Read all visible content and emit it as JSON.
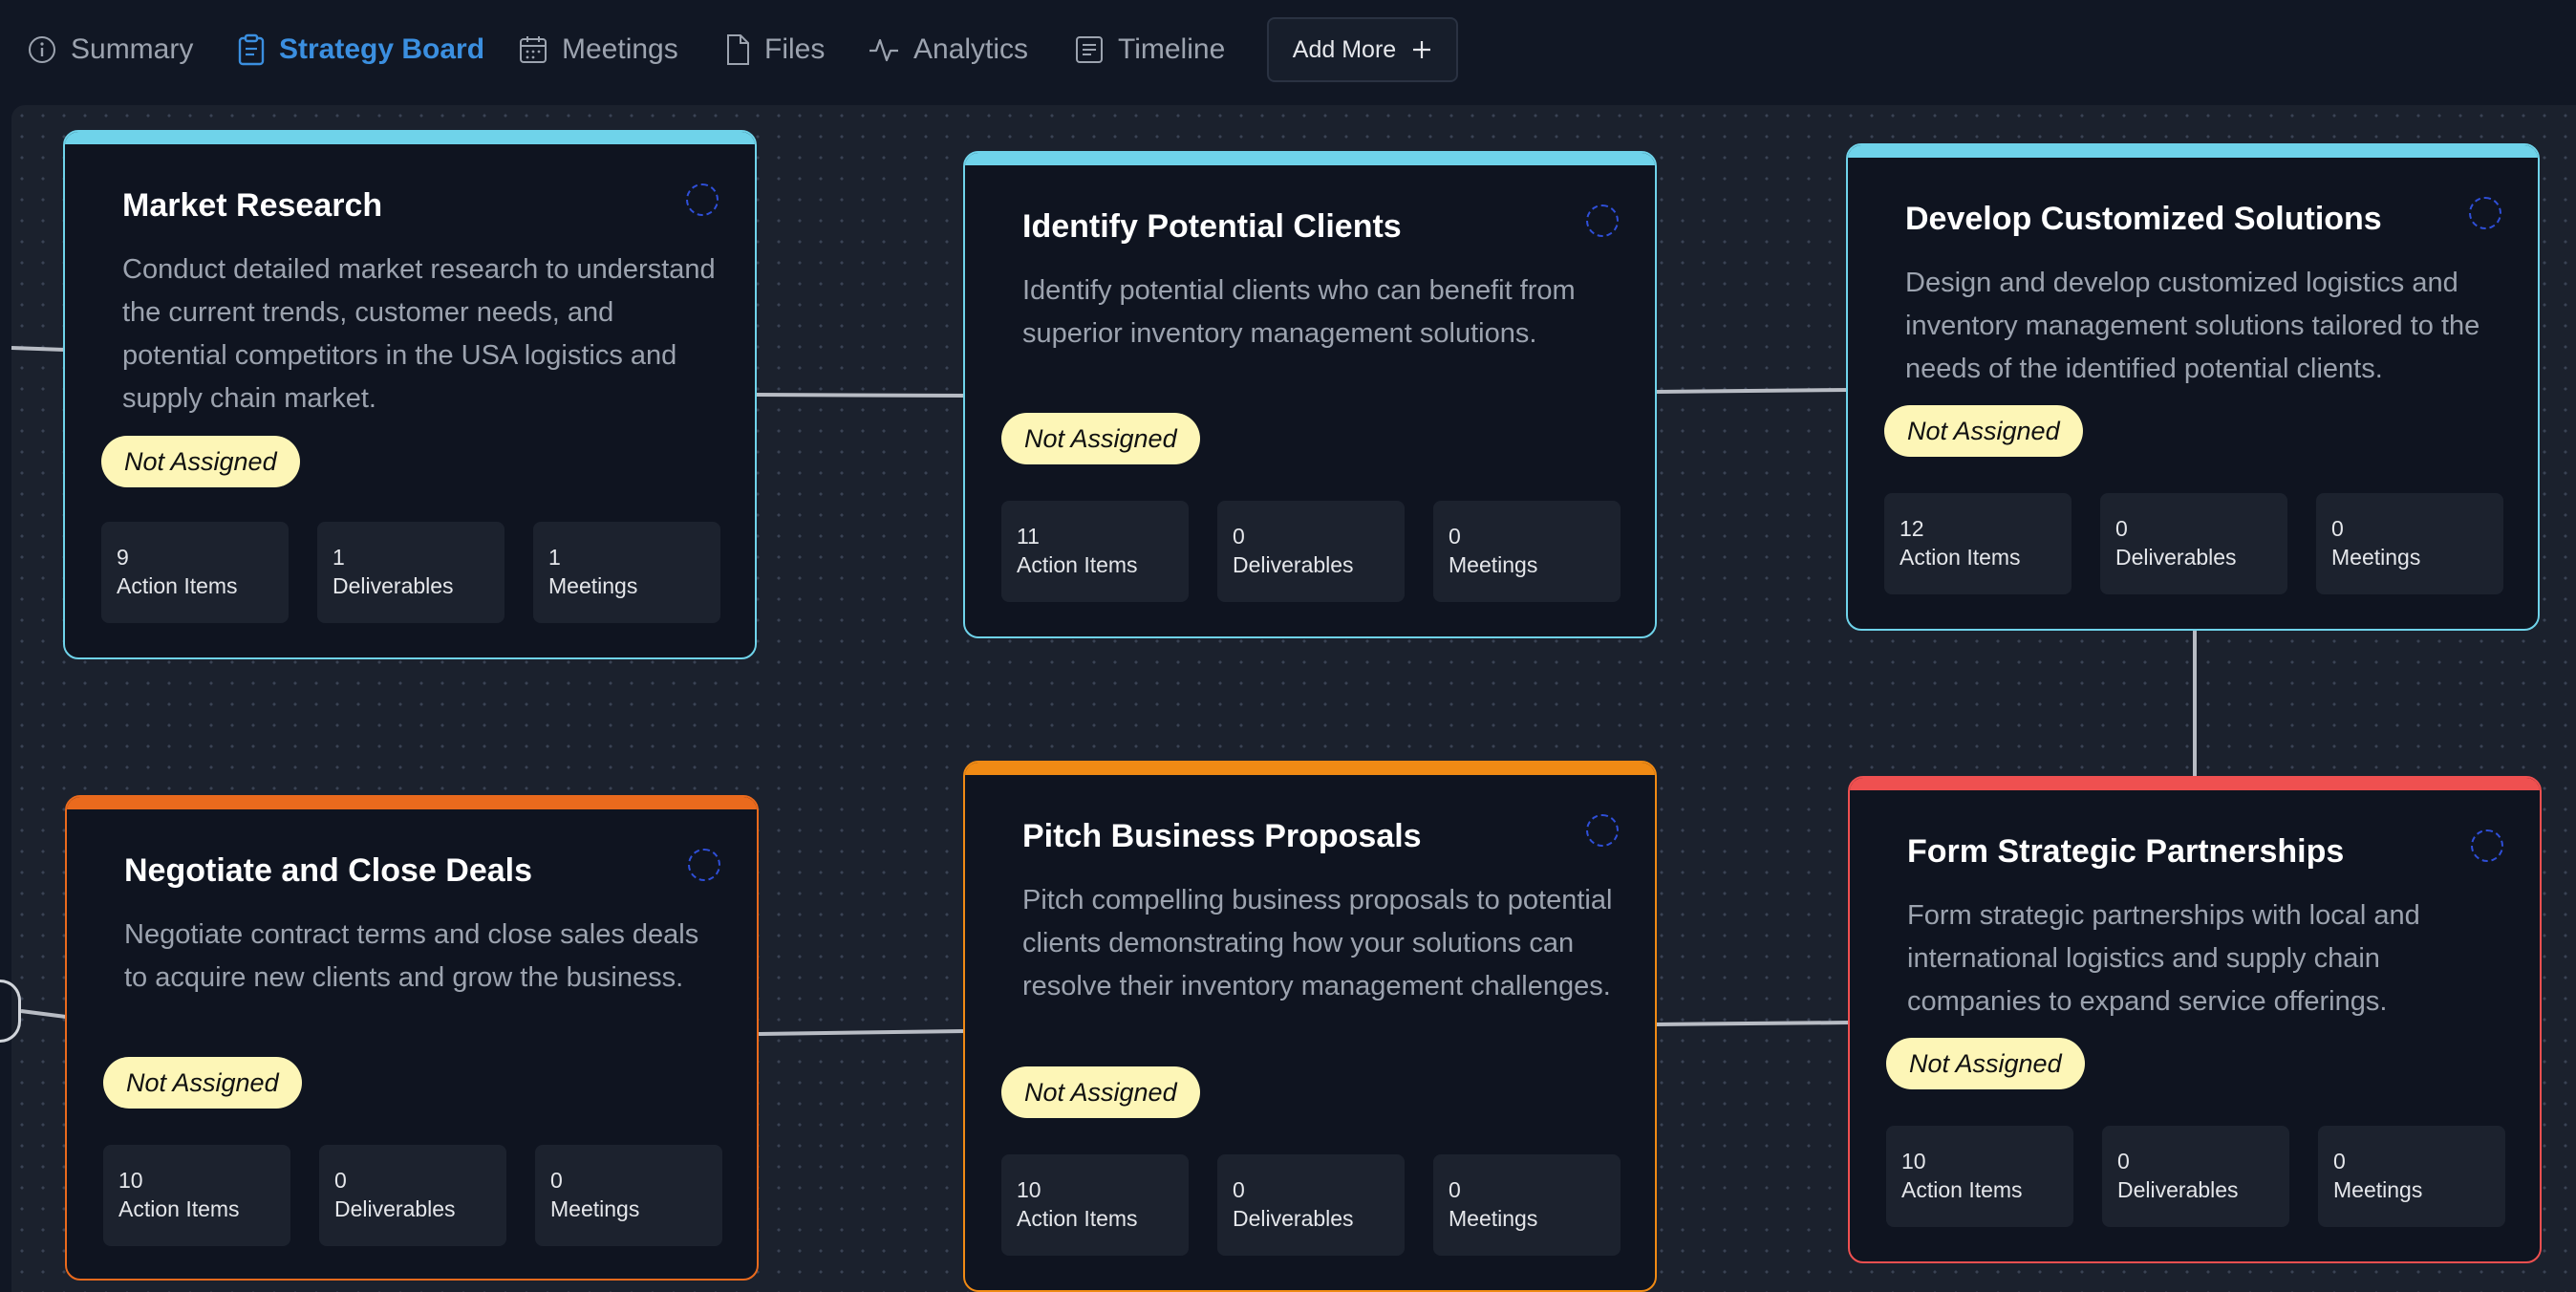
{
  "tabs": [
    {
      "label": "Summary",
      "icon": "info-icon"
    },
    {
      "label": "Strategy Board",
      "icon": "clipboard-icon",
      "active": true
    },
    {
      "label": "Meetings",
      "icon": "calendar-icon"
    },
    {
      "label": "Files",
      "icon": "file-icon"
    },
    {
      "label": "Analytics",
      "icon": "activity-icon"
    },
    {
      "label": "Timeline",
      "icon": "timeline-icon"
    }
  ],
  "add_more": {
    "label": "Add More",
    "icon": "plus-icon"
  },
  "colors": {
    "accent": "#3b8fe0",
    "cyan": "#6fd3ea",
    "orange": "#f08a14",
    "dark_orange": "#ea6a1d",
    "red": "#ef5050",
    "badge": "#fdf6b7"
  },
  "cards": [
    {
      "title": "Market Research",
      "description": "Conduct detailed market research to understand the current trends, customer needs, and potential competitors in the USA logistics and supply chain market.",
      "status": "Not Assigned",
      "color": "cyan",
      "stats": [
        {
          "value": "9",
          "label": "Action Items"
        },
        {
          "value": "1",
          "label": "Deliverables"
        },
        {
          "value": "1",
          "label": "Meetings"
        }
      ]
    },
    {
      "title": "Identify Potential Clients",
      "description": "Identify potential clients who can benefit from superior inventory management solutions.",
      "status": "Not Assigned",
      "color": "cyan",
      "stats": [
        {
          "value": "11",
          "label": "Action Items"
        },
        {
          "value": "0",
          "label": "Deliverables"
        },
        {
          "value": "0",
          "label": "Meetings"
        }
      ]
    },
    {
      "title": "Develop Customized Solutions",
      "description": "Design and develop customized logistics and inventory management solutions tailored to the needs of the identified potential clients.",
      "status": "Not Assigned",
      "color": "cyan",
      "stats": [
        {
          "value": "12",
          "label": "Action Items"
        },
        {
          "value": "0",
          "label": "Deliverables"
        },
        {
          "value": "0",
          "label": "Meetings"
        }
      ]
    },
    {
      "title": "Negotiate and Close Deals",
      "description": "Negotiate contract terms and close sales deals to acquire new clients and grow the business.",
      "status": "Not Assigned",
      "color": "dark_orange",
      "stats": [
        {
          "value": "10",
          "label": "Action Items"
        },
        {
          "value": "0",
          "label": "Deliverables"
        },
        {
          "value": "0",
          "label": "Meetings"
        }
      ]
    },
    {
      "title": "Pitch Business Proposals",
      "description": "Pitch compelling business proposals to potential clients demonstrating how your solutions can resolve their inventory management challenges.",
      "status": "Not Assigned",
      "color": "orange",
      "stats": [
        {
          "value": "10",
          "label": "Action Items"
        },
        {
          "value": "0",
          "label": "Deliverables"
        },
        {
          "value": "0",
          "label": "Meetings"
        }
      ]
    },
    {
      "title": "Form Strategic Partnerships",
      "description": "Form strategic partnerships with local and international logistics and supply chain companies to expand service offerings.",
      "status": "Not Assigned",
      "color": "red",
      "stats": [
        {
          "value": "10",
          "label": "Action Items"
        },
        {
          "value": "0",
          "label": "Deliverables"
        },
        {
          "value": "0",
          "label": "Meetings"
        }
      ]
    }
  ]
}
